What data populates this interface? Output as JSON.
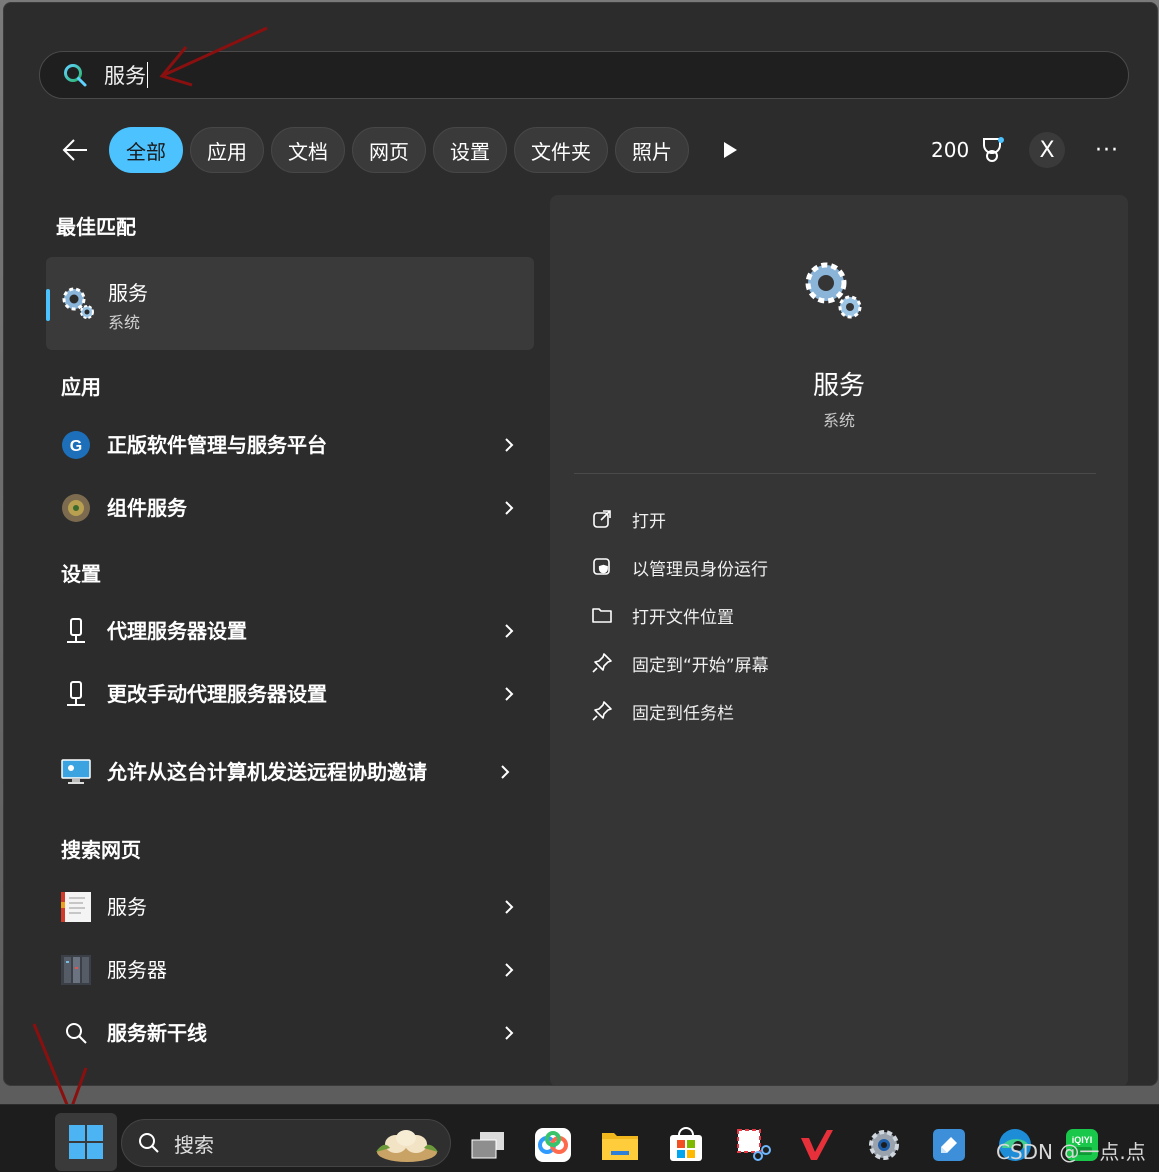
{
  "search": {
    "query": "服务"
  },
  "filters": {
    "tabs": [
      "全部",
      "应用",
      "文档",
      "网页",
      "设置",
      "文件夹",
      "照片"
    ],
    "points": "200",
    "account_initial": "X",
    "more": "···"
  },
  "left": {
    "best_match_title": "最佳匹配",
    "best_match": {
      "name": "服务",
      "sub": "系统"
    },
    "apps_title": "应用",
    "apps": [
      "正版软件管理与服务平台",
      "组件服务"
    ],
    "settings_title": "设置",
    "settings": [
      "代理服务器设置",
      "更改手动代理服务器设置",
      "允许从这台计算机发送远程协助邀请"
    ],
    "web_title": "搜索网页",
    "web": [
      "服务",
      "服务器",
      "服务新干线"
    ]
  },
  "detail": {
    "name": "服务",
    "sub": "系统",
    "actions": [
      "打开",
      "以管理员身份运行",
      "打开文件位置",
      "固定到“开始”屏幕",
      "固定到任务栏"
    ]
  },
  "taskbar": {
    "search_label": "搜索",
    "apps": [
      "task-view",
      "baidu-netdisk",
      "file-explorer",
      "microsoft-store",
      "snipping-tool",
      "wps",
      "settings",
      "vscode-like",
      "edge",
      "iqiyi"
    ]
  },
  "watermark": "CSDN @一点.点"
}
